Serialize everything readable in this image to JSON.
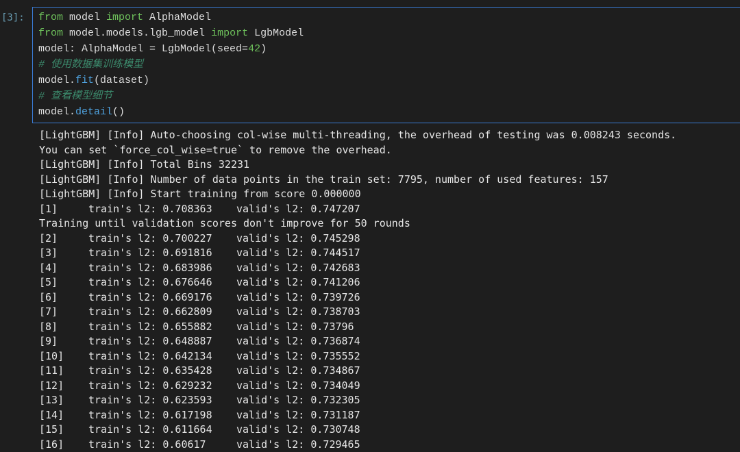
{
  "cell": {
    "prompt": "[3]:",
    "code": {
      "line1": {
        "kw1": "from",
        "mod": " model ",
        "kw2": "import",
        "name": " AlphaModel"
      },
      "line2": {
        "kw1": "from",
        "mod": " model.models.lgb_model ",
        "kw2": "import",
        "name": " LgbModel"
      },
      "line3": {
        "pre": "model: AlphaModel = LgbModel(seed=",
        "num": "42",
        "post": ")"
      },
      "comment1": "# 使用数据集训练模型",
      "line5": {
        "obj": "model.",
        "method": "fit",
        "args": "(dataset)"
      },
      "comment2": "# 查看模型细节",
      "line7": {
        "obj": "model.",
        "method": "detail",
        "args": "()"
      }
    }
  },
  "output": {
    "lines": [
      "[LightGBM] [Info] Auto-choosing col-wise multi-threading, the overhead of testing was 0.008243 seconds.",
      "You can set `force_col_wise=true` to remove the overhead.",
      "[LightGBM] [Info] Total Bins 32231",
      "[LightGBM] [Info] Number of data points in the train set: 7795, number of used features: 157",
      "[LightGBM] [Info] Start training from score 0.000000"
    ],
    "first_round": {
      "idx": "[1]",
      "train": "train's l2: 0.708363",
      "valid": "valid's l2: 0.747207"
    },
    "early_stop_msg": "Training until validation scores don't improve for 50 rounds",
    "rounds": [
      {
        "idx": "[2]",
        "train": "train's l2: 0.700227",
        "valid": "valid's l2: 0.745298"
      },
      {
        "idx": "[3]",
        "train": "train's l2: 0.691816",
        "valid": "valid's l2: 0.744517"
      },
      {
        "idx": "[4]",
        "train": "train's l2: 0.683986",
        "valid": "valid's l2: 0.742683"
      },
      {
        "idx": "[5]",
        "train": "train's l2: 0.676646",
        "valid": "valid's l2: 0.741206"
      },
      {
        "idx": "[6]",
        "train": "train's l2: 0.669176",
        "valid": "valid's l2: 0.739726"
      },
      {
        "idx": "[7]",
        "train": "train's l2: 0.662809",
        "valid": "valid's l2: 0.738703"
      },
      {
        "idx": "[8]",
        "train": "train's l2: 0.655882",
        "valid": "valid's l2: 0.73796"
      },
      {
        "idx": "[9]",
        "train": "train's l2: 0.648887",
        "valid": "valid's l2: 0.736874"
      },
      {
        "idx": "[10]",
        "train": "train's l2: 0.642134",
        "valid": "valid's l2: 0.735552"
      },
      {
        "idx": "[11]",
        "train": "train's l2: 0.635428",
        "valid": "valid's l2: 0.734867"
      },
      {
        "idx": "[12]",
        "train": "train's l2: 0.629232",
        "valid": "valid's l2: 0.734049"
      },
      {
        "idx": "[13]",
        "train": "train's l2: 0.623593",
        "valid": "valid's l2: 0.732305"
      },
      {
        "idx": "[14]",
        "train": "train's l2: 0.617198",
        "valid": "valid's l2: 0.731187"
      },
      {
        "idx": "[15]",
        "train": "train's l2: 0.611664",
        "valid": "valid's l2: 0.730748"
      },
      {
        "idx": "[16]",
        "train": "train's l2: 0.60617",
        "valid": "valid's l2: 0.729465"
      }
    ]
  }
}
